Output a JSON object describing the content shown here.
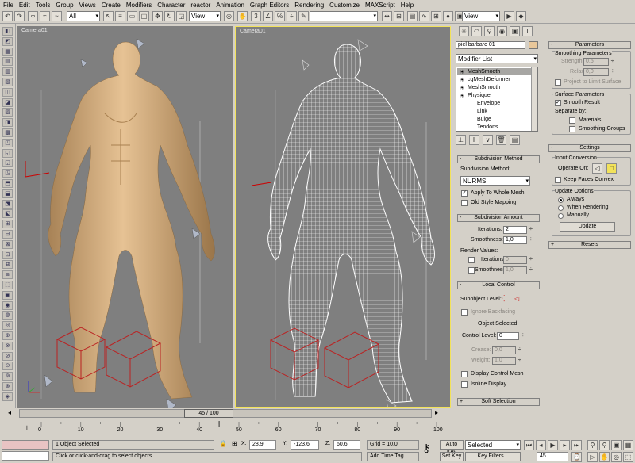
{
  "menu": [
    "File",
    "Edit",
    "Tools",
    "Group",
    "Views",
    "Create",
    "Modifiers",
    "Character",
    "reactor",
    "Animation",
    "Graph Editors",
    "Rendering",
    "Customize",
    "MAXScript",
    "Help"
  ],
  "toolbar": {
    "selection_filter": "All",
    "ref_coord": "View",
    "ref_coord2": "View"
  },
  "viewports": {
    "left_label": "Camera01",
    "right_label": "Camera01"
  },
  "object_name": "piel barbaro 01",
  "modifier_list_label": "Modifier List",
  "modifier_stack": [
    "MeshSmooth",
    "cgMeshDeformer",
    "MeshSmooth",
    "Physique",
    "Envelope",
    "Link",
    "Bulge",
    "Tendons"
  ],
  "subdivision_method": {
    "title": "Subdivision Method",
    "method_label": "Subdivision Method:",
    "method_value": "NURMS",
    "apply_whole_mesh": "Apply To Whole Mesh",
    "old_style": "Old Style Mapping"
  },
  "subdivision_amount": {
    "title": "Subdivision Amount",
    "iterations_label": "Iterations:",
    "iterations_value": "2",
    "smoothness_label": "Smoothness:",
    "smoothness_value": "1,0",
    "render_values_label": "Render Values:",
    "r_iterations_label": "Iterations",
    "r_iterations_value": "0",
    "r_smoothness_label": "Smoothness",
    "r_smoothness_value": "1,0"
  },
  "local_control": {
    "title": "Local Control",
    "subobject_label": "Subobject Level:",
    "ignore_backfacing": "Ignore Backfacing",
    "object_selected": "Object Selected",
    "control_level_label": "Control Level:",
    "control_level_value": "0",
    "crease_label": "Crease:",
    "crease_value": "0,0",
    "weight_label": "Weight:",
    "weight_value": "1,0",
    "display_control_mesh": "Display Control Mesh",
    "isoline_display": "Isoline Display"
  },
  "soft_selection_title": "Soft Selection",
  "parameters": {
    "title": "Parameters",
    "smoothing_params": "Smoothing Parameters",
    "strength_label": "Strength:",
    "strength_value": "0,5",
    "relax_label": "Relax:",
    "relax_value": "0,0",
    "project_limit": "Project to Limit Surface",
    "surface_params": "Surface Parameters",
    "smooth_result": "Smooth Result",
    "separate_by": "Separate by:",
    "materials": "Materials",
    "smoothing_groups": "Smoothing Groups"
  },
  "settings": {
    "title": "Settings",
    "input_conversion": "Input Conversion",
    "operate_on": "Operate On:",
    "keep_faces_convex": "Keep Faces Convex",
    "update_options": "Update Options",
    "always": "Always",
    "when_rendering": "When Rendering",
    "manually": "Manually",
    "update_button": "Update"
  },
  "resets_title": "Resets",
  "timeline": {
    "frame_display": "45 / 100",
    "current_frame": 45,
    "total_frames": 100,
    "ticks": [
      "0",
      "10",
      "20",
      "30",
      "40",
      "50",
      "60",
      "70",
      "80",
      "90",
      "100"
    ]
  },
  "status": {
    "selection_text": "1 Object Selected",
    "prompt_text": "Click or click-and-drag to select objects",
    "x_label": "X:",
    "x_value": "28,9",
    "y_label": "Y:",
    "y_value": "-123,6",
    "z_label": "Z:",
    "z_value": "60,6",
    "grid": "Grid = 10,0",
    "add_time_tag": "Add Time Tag",
    "auto_key": "Auto Key",
    "set_key": "Set Key",
    "selected_dropdown": "Selected",
    "key_filters": "Key Filters...",
    "frame_field": "45"
  },
  "colors": {
    "skin": "#d8b384",
    "viewport_bg": "#7f7f7f",
    "active_viewport_border": "#f2e25a",
    "selected_stack": "#a7a6a3"
  }
}
